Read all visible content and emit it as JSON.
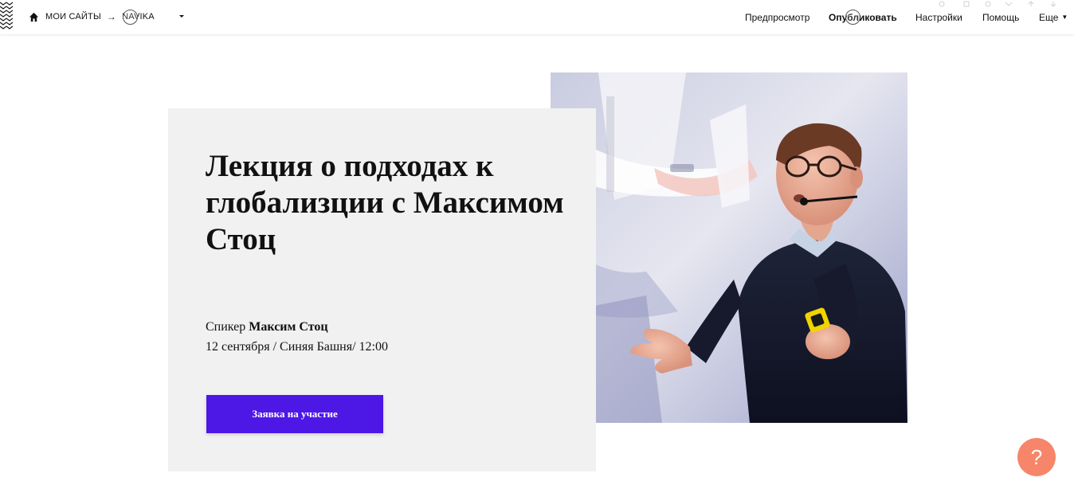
{
  "topbar": {
    "breadcrumb": {
      "home_icon": "home-icon",
      "my_sites": "МОИ САЙТЫ",
      "arrow": "→",
      "site_name": "NAVIKA"
    },
    "nav": {
      "preview": "Предпросмотр",
      "publish": "Опубликовать",
      "settings": "Настройки",
      "help": "Помощь",
      "more": "Еще",
      "more_caret": "▼"
    }
  },
  "hero": {
    "title": "Лекция о подходах к глобализции с Максимом Стоц",
    "speaker_prefix": "Спикер ",
    "speaker_name": "Максим Стоц",
    "event_info": "12 сентября / Синяя Башня/ 12:00",
    "cta_label": "Заявка на участие",
    "photo": "speaker-photo"
  },
  "help_button": {
    "label": "?"
  },
  "colors": {
    "accent": "#4d17e6",
    "card_bg": "#f1f1f1",
    "help_bg": "#f7856a"
  }
}
